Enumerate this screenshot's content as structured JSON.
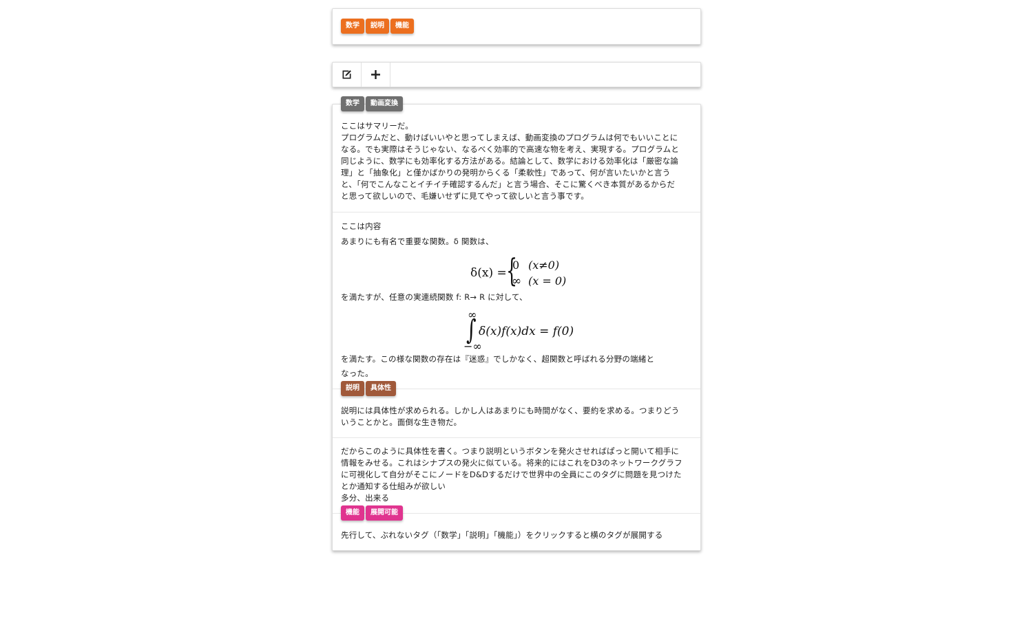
{
  "top_tags": [
    "数学",
    "説明",
    "機能"
  ],
  "toolbar": {
    "edit_icon": "edit-icon",
    "add_icon": "plus-icon"
  },
  "post": {
    "tags": [
      "数学",
      "動画変換"
    ],
    "summary_lines": [
      "ここはサマリーだ。",
      "プログラムだと、動けばいいやと思ってしまえば、動画変換のプログラムは何でもいいことに",
      "なる。でも実際はそうじゃない、なるべく効率的で高速な物を考え、実現する。プログラムと",
      "同じように、数学にも効率化する方法がある。結論として、数学における効率化は「厳密な論",
      "理」と「抽象化」と僅かばかりの発明からくる「柔軟性」であって、何が言いたいかと言う",
      "と、「何でこんなことイチイチ確認するんだ」と言う場合、そこに驚くべき本質があるからだ",
      "と思って欲しいので、毛嫌いせずに見てやって欲しいと言う事です。"
    ],
    "content_heading": "ここは内容",
    "content_intro": "あまりにも有名で重要な関数。δ 関数は、",
    "formula1": {
      "lhs": "δ(x) =",
      "case1_value": "0",
      "case1_cond": "(x≠0)",
      "case2_value": "∞",
      "case2_cond": "(x = 0)"
    },
    "content_middle": "を満たすが、任意の実連続関数 f: R→ R に対して、",
    "formula2": {
      "upper": "∞",
      "lower": "−∞",
      "body": "δ(x)f(x)dx = f(0)"
    },
    "content_outro_lines": [
      "を満たす。この様な関数の存在は『迷惑』でしかなく、超関数と呼ばれる分野の端緒と",
      "なった。"
    ],
    "explain_tags": [
      "説明",
      "具体性"
    ],
    "explain_lines": [
      "説明には具体性が求められる。しかし人はあまりにも時間がなく、要約を求める。つまりどう",
      "いうことかと。面倒な生き物だ。"
    ],
    "detail_lines": [
      "だからこのように具体性を書く。つまり説明というボタンを発火させればぱっと開いて相手に",
      "情報をみせる。これはシナプスの発火に似ている。将来的にはこれをD3のネットワークグラフ",
      "に可視化して自分がそこにノードをD&Dするだけで世界中の全員にこのタグに問題を見つけた",
      "とか通知する仕組みが欲しい",
      "多分、出来る"
    ],
    "feature_tags": [
      "機能",
      "展開可能"
    ],
    "feature_line": "先行して、ぶれないタグ（「数学」「説明」「機能」）をクリックすると横のタグが展開する"
  },
  "colors": {
    "orange": "#ec6f1f",
    "gray": "#6f6f6f",
    "brown": "#a0593a",
    "pink": "#e0348f"
  }
}
